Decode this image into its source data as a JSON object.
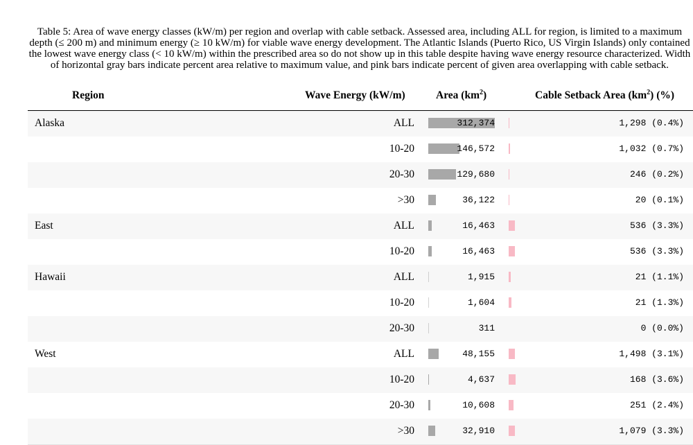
{
  "caption": "Table 5: Area of wave energy classes (kW/m) per region and overlap with cable setback. Assessed area, including ALL for region, is limited to a maximum depth (≤ 200 m) and minimum energy (≥ 10 kW/m) for viable wave energy development. The Atlantic Islands (Puerto Rico, US Virgin Islands) only contained the lowest wave energy class (< 10 kW/m) within the prescribed area so do not show up in this table despite having wave energy resource characterized. Width of horizontal gray bars indicate percent area relative to maximum value, and pink bars indicate percent of given area overlapping with cable setback.",
  "headers": {
    "region": "Region",
    "energy": "Wave Energy (kW/m)",
    "area_prefix": "Area (km",
    "area_sup": "2",
    "area_suffix": ")",
    "cable_prefix": "Cable Setback Area (km",
    "cable_sup": "2",
    "cable_suffix": ") (%)"
  },
  "colors": {
    "area_bar": "#a8a8a8",
    "setback_bar": "#f8b9c5"
  },
  "rows": [
    {
      "region": "Alaska",
      "energy": "ALL",
      "area": "312,374",
      "area_pct": 100,
      "cable": "1,298 (0.4%)",
      "setback_pct": 0.4
    },
    {
      "region": "",
      "energy": "10-20",
      "area": "146,572",
      "area_pct": 46.9,
      "cable": "1,032 (0.7%)",
      "setback_pct": 0.7
    },
    {
      "region": "",
      "energy": "20-30",
      "area": "129,680",
      "area_pct": 41.5,
      "cable": "246 (0.2%)",
      "setback_pct": 0.2
    },
    {
      "region": "",
      "energy": ">30",
      "area": "36,122",
      "area_pct": 11.6,
      "cable": "20 (0.1%)",
      "setback_pct": 0.1
    },
    {
      "region": "East",
      "energy": "ALL",
      "area": "16,463",
      "area_pct": 5.3,
      "cable": "536 (3.3%)",
      "setback_pct": 3.3
    },
    {
      "region": "",
      "energy": "10-20",
      "area": "16,463",
      "area_pct": 5.3,
      "cable": "536 (3.3%)",
      "setback_pct": 3.3
    },
    {
      "region": "Hawaii",
      "energy": "ALL",
      "area": "1,915",
      "area_pct": 0.6,
      "cable": "21 (1.1%)",
      "setback_pct": 1.1
    },
    {
      "region": "",
      "energy": "10-20",
      "area": "1,604",
      "area_pct": 0.5,
      "cable": "21 (1.3%)",
      "setback_pct": 1.3
    },
    {
      "region": "",
      "energy": "20-30",
      "area": "311",
      "area_pct": 0.1,
      "cable": "0 (0.0%)",
      "setback_pct": 0.0
    },
    {
      "region": "West",
      "energy": "ALL",
      "area": "48,155",
      "area_pct": 15.4,
      "cable": "1,498 (3.1%)",
      "setback_pct": 3.1
    },
    {
      "region": "",
      "energy": "10-20",
      "area": "4,637",
      "area_pct": 1.5,
      "cable": "168 (3.6%)",
      "setback_pct": 3.6
    },
    {
      "region": "",
      "energy": "20-30",
      "area": "10,608",
      "area_pct": 3.4,
      "cable": "251 (2.4%)",
      "setback_pct": 2.4
    },
    {
      "region": "",
      "energy": ">30",
      "area": "32,910",
      "area_pct": 10.5,
      "cable": "1,079 (3.3%)",
      "setback_pct": 3.3
    }
  ]
}
